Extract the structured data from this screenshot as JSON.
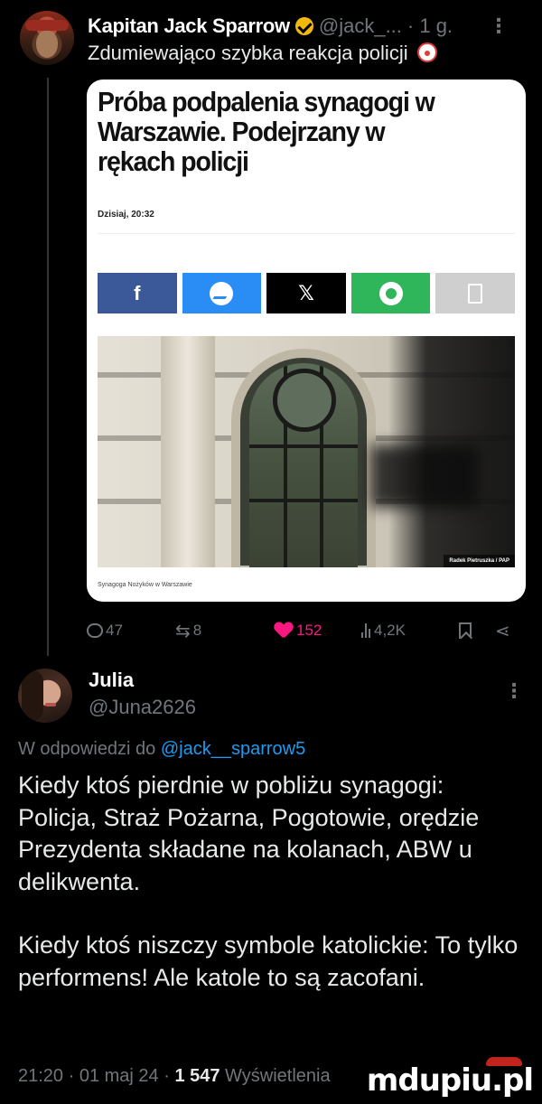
{
  "tweet": {
    "author_name": "Kapitan Jack Sparrow",
    "handle": "@jack_...",
    "time": "· 1 g.",
    "text": "Zdumiewająco szybka reakcja policji",
    "text_emoji": "clown-emoji",
    "card": {
      "headline": "Próba podpalenia synagogi w Warszawie. Podejrzany w rękach policji",
      "date": "Dzisiaj, 20:32",
      "share_buttons": [
        {
          "name": "facebook",
          "label": "f",
          "color": "#3b5998"
        },
        {
          "name": "messenger",
          "label": "",
          "color": "#2a8cf5"
        },
        {
          "name": "x",
          "label": "𝕏",
          "color": "#000000"
        },
        {
          "name": "whatsapp",
          "label": "",
          "color": "#2fb55a"
        },
        {
          "name": "copy",
          "label": "",
          "color": "#cfcfcf"
        }
      ],
      "photo_credit": "Radek Pietruszka / PAP",
      "caption": "Synagoga Nożyków w Warszawie"
    },
    "actions": {
      "replies": "47",
      "retweets": "8",
      "likes": "152",
      "views": "4,2K"
    }
  },
  "reply": {
    "author_name": "Julia",
    "handle": "@Juna2626",
    "reply_prefix": "W odpowiedzi do ",
    "reply_mention": "@jack__sparrow5",
    "paragraphs": [
      "Kiedy ktoś pierdnie w pobliżu synagogi: Policja, Straż Pożarna, Pogotowie, orędzie Prezydenta składane na kolanach, ABW u delikwenta.",
      "Kiedy ktoś niszczy symbole katolickie: To tylko performens! Ale katole to są zacofani."
    ],
    "time_date": "21:20 · 01 maj 24 · ",
    "views_count": "1 547",
    "views_label": " Wyświetlenia"
  },
  "watermark": "mdupiu.pl",
  "colors": {
    "background": "#000000",
    "muted": "#71767b",
    "link": "#1d9bf0",
    "like": "#f91880",
    "verified": "#f0b90b"
  }
}
